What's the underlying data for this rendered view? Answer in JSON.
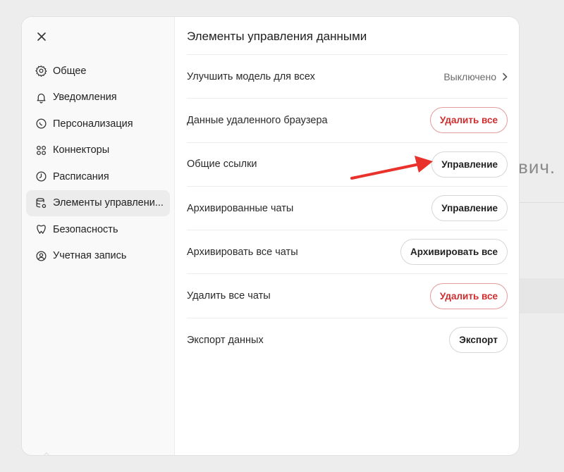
{
  "background": {
    "partial_text": "вич."
  },
  "sidebar": {
    "close_icon": "close-icon",
    "items": [
      {
        "label": "Общее",
        "icon": "gear-icon",
        "active": false
      },
      {
        "label": "Уведомления",
        "icon": "bell-icon",
        "active": false
      },
      {
        "label": "Персонализация",
        "icon": "personalization-icon",
        "active": false
      },
      {
        "label": "Коннекторы",
        "icon": "connectors-icon",
        "active": false
      },
      {
        "label": "Расписания",
        "icon": "clock-icon",
        "active": false
      },
      {
        "label": "Элементы управлени...",
        "icon": "database-gear-icon",
        "active": true
      },
      {
        "label": "Безопасность",
        "icon": "shield-icon",
        "active": false
      },
      {
        "label": "Учетная запись",
        "icon": "account-icon",
        "active": false
      }
    ]
  },
  "main": {
    "title": "Элементы управления данными",
    "rows": [
      {
        "label": "Улучшить модель для всех",
        "value": "Выключено"
      },
      {
        "label": "Данные удаленного браузера",
        "button": "Удалить все"
      },
      {
        "label": "Общие ссылки",
        "button": "Управление"
      },
      {
        "label": "Архивированные чаты",
        "button": "Управление"
      },
      {
        "label": "Архивировать все чаты",
        "button": "Архивировать все"
      },
      {
        "label": "Удалить все чаты",
        "button": "Удалить все"
      },
      {
        "label": "Экспорт данных",
        "button": "Экспорт"
      }
    ]
  },
  "colors": {
    "danger": "#d02c2c",
    "annotation_arrow": "#e8322b"
  }
}
